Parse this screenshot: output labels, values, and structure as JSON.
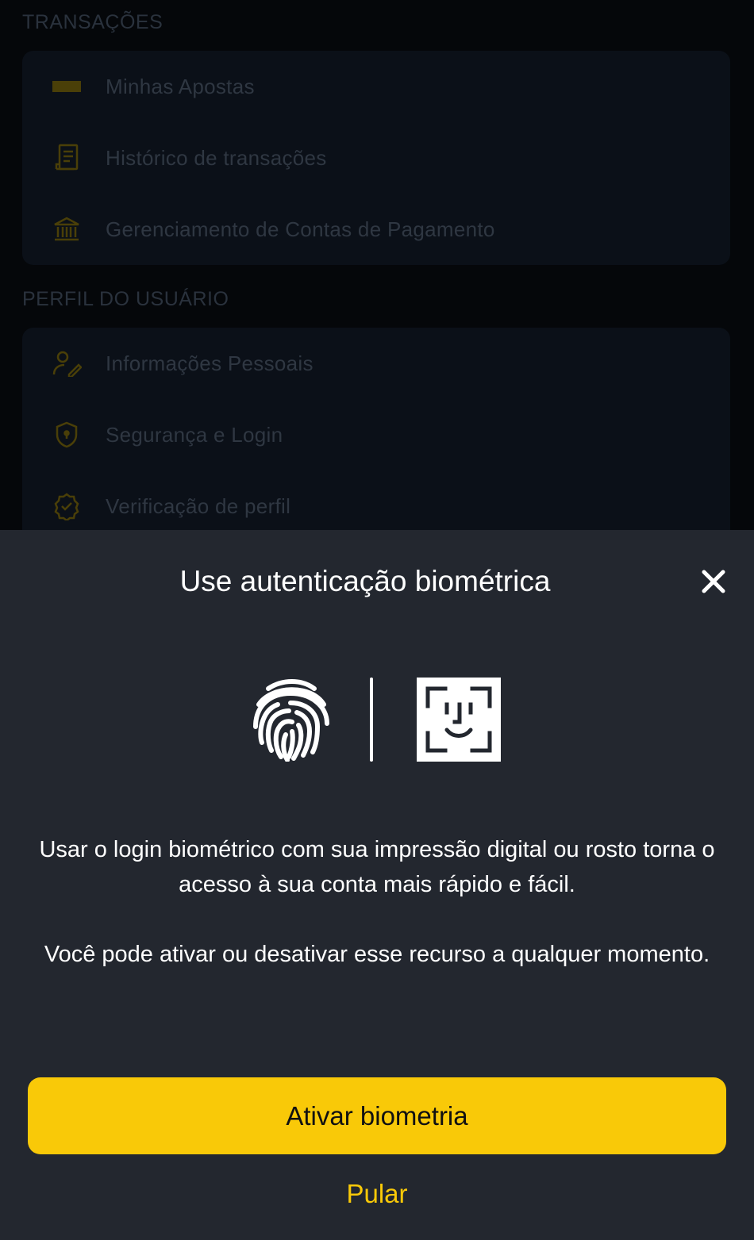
{
  "menu": {
    "transactions_title": "TRANSAÇÕES",
    "transactions_items": [
      {
        "label": "Minhas Apostas",
        "icon": "ticket-icon"
      },
      {
        "label": "Histórico de transações",
        "icon": "receipt-icon"
      },
      {
        "label": "Gerenciamento de Contas de Pagamento",
        "icon": "bank-icon"
      }
    ],
    "profile_title": "PERFIL DO USUÁRIO",
    "profile_items": [
      {
        "label": "Informações Pessoais",
        "icon": "user-edit-icon"
      },
      {
        "label": "Segurança e Login",
        "icon": "shield-icon"
      },
      {
        "label": "Verificação de perfil",
        "icon": "verified-badge-icon"
      }
    ]
  },
  "sheet": {
    "title": "Use autenticação biométrica",
    "close_icon": "close-icon",
    "icons": [
      "fingerprint-icon",
      "face-id-icon"
    ],
    "paragraph1": "Usar o login biométrico com sua impressão digital ou rosto torna o acesso à sua conta mais rápido e fácil.",
    "paragraph2": "Você pode ativar ou desativar esse recurso a qualquer momento.",
    "primary_button": "Ativar biometria",
    "skip_button": "Pular"
  },
  "colors": {
    "accent": "#f9c908",
    "sheet_background": "#23272f",
    "menu_background": "#05070a",
    "text_primary": "#ffffff"
  }
}
